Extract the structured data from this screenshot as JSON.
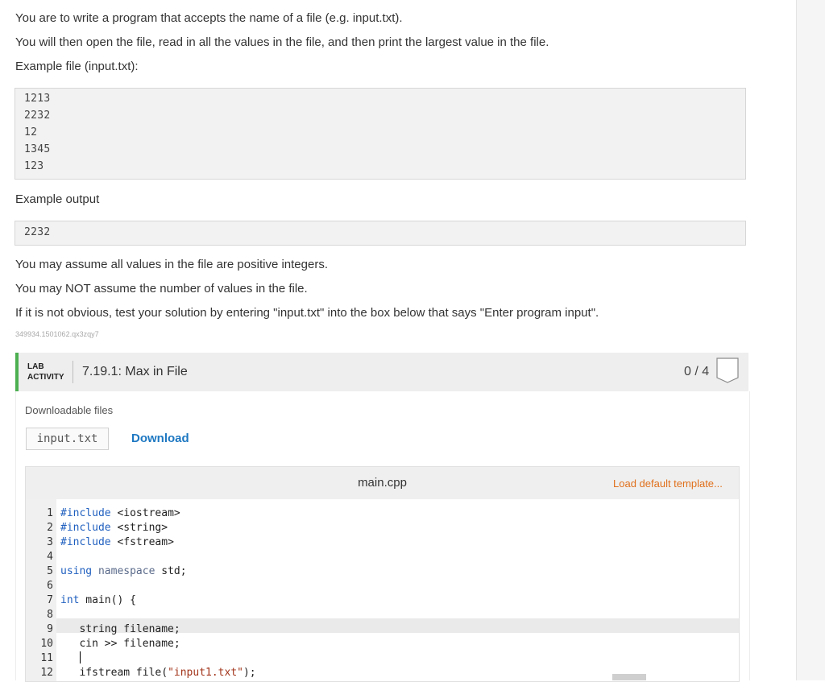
{
  "instructions": {
    "line1": "You are to write a program that accepts the name of a file (e.g. input.txt).",
    "line2": "You will then open the file, read in all the values in the file, and then print the largest value in the file.",
    "line3": "Example file (input.txt):",
    "example_file_lines": [
      "1213",
      "2232",
      "12",
      "1345",
      "123"
    ],
    "example_output_label": "Example output",
    "example_output": "2232",
    "line4": "You may assume all values in the file are positive integers.",
    "line5": "You may NOT assume the number of values in the file.",
    "line6": "If it is not obvious, test your solution by entering \"input.txt\" into the box below that says \"Enter program input\".",
    "id_code": "349934.1501062.qx3zqy7"
  },
  "lab": {
    "label_line1": "LAB",
    "label_line2": "ACTIVITY",
    "title": "7.19.1: Max in File",
    "score": "0 / 4"
  },
  "downloads": {
    "label": "Downloadable files",
    "file": "input.txt",
    "button": "Download"
  },
  "editor": {
    "filename": "main.cpp",
    "load_template": "Load default template...",
    "lines": [
      {
        "n": "1",
        "parts": [
          [
            "kw",
            "#include"
          ],
          [
            "",
            " <iostream>"
          ]
        ]
      },
      {
        "n": "2",
        "parts": [
          [
            "kw",
            "#include"
          ],
          [
            "",
            " <string>"
          ]
        ]
      },
      {
        "n": "3",
        "parts": [
          [
            "kw",
            "#include"
          ],
          [
            "",
            " <fstream>"
          ]
        ]
      },
      {
        "n": "4",
        "parts": []
      },
      {
        "n": "5",
        "parts": [
          [
            "kw",
            "using"
          ],
          [
            "",
            " "
          ],
          [
            "nm",
            "namespace"
          ],
          [
            "",
            " std;"
          ]
        ]
      },
      {
        "n": "6",
        "parts": []
      },
      {
        "n": "7",
        "parts": [
          [
            "kw",
            "int"
          ],
          [
            "",
            " main() {"
          ]
        ]
      },
      {
        "n": "8",
        "parts": []
      },
      {
        "n": "9",
        "parts": [
          [
            "",
            "   string filename;"
          ]
        ]
      },
      {
        "n": "10",
        "parts": [
          [
            "",
            "   cin >> filename;"
          ]
        ]
      },
      {
        "n": "11",
        "parts": []
      },
      {
        "n": "12",
        "parts": [
          [
            "",
            "   ifstream file("
          ],
          [
            "str",
            "\"input1.txt\""
          ],
          [
            "",
            ");"
          ]
        ]
      }
    ]
  }
}
